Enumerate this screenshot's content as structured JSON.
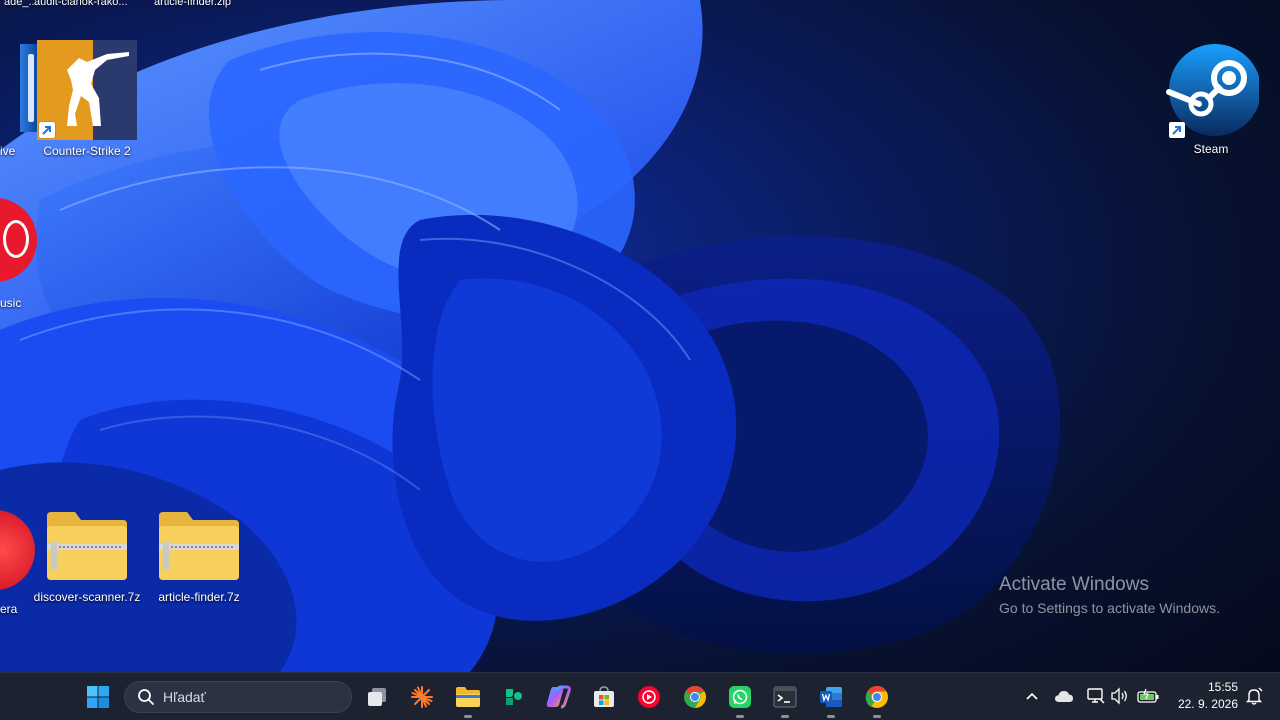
{
  "desktop": {
    "top_labels": [
      "ade_...",
      "audit-clanok-rako...",
      "article-finder.zip"
    ],
    "icons": [
      {
        "label": "ive",
        "icon": "onedrive-icon"
      },
      {
        "label": "Counter-Strike 2",
        "icon": "counter-strike-icon"
      },
      {
        "label": "usic",
        "icon": "youtube-music-icon"
      },
      {
        "label": "era",
        "icon": "opera-icon"
      },
      {
        "label": "discover-scanner.7z",
        "icon": "zip-folder-icon"
      },
      {
        "label": "article-finder.7z",
        "icon": "zip-folder-icon"
      },
      {
        "label": "Steam",
        "icon": "steam-icon"
      }
    ],
    "watermark": {
      "title": "Activate Windows",
      "subtitle": "Go to Settings to activate Windows."
    }
  },
  "taskbar": {
    "search_placeholder": "Hľadať",
    "pinned": [
      "windows-start-icon",
      "task-view-icon",
      "app-sparkle-icon",
      "file-explorer-icon",
      "app-green-icon",
      "copilot-icon",
      "microsoft-store-icon",
      "youtube-music-icon",
      "chrome-icon",
      "whatsapp-icon",
      "terminal-icon",
      "word-icon",
      "chrome-canary-icon"
    ],
    "tray": [
      "chevron-up-icon",
      "onedrive-cloud-icon",
      "network-icon",
      "speaker-icon",
      "battery-icon",
      "notification-icon"
    ],
    "time": "15:55",
    "date": "22. 9. 2026"
  },
  "colors": {
    "taskbar_bg": "#1d2230",
    "wallpaper_accent": "#1a4dff",
    "desktop_dark": "#050b1e"
  }
}
